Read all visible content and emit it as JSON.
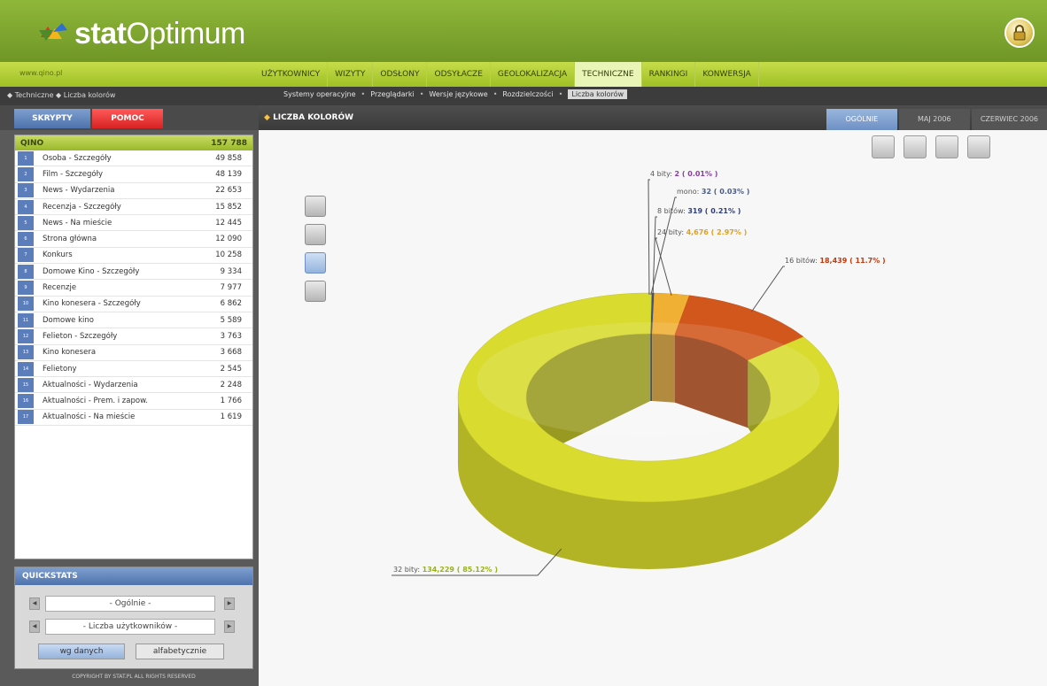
{
  "header": {
    "brand_bold": "stat",
    "brand_light": "Optimum"
  },
  "nav": {
    "site": "www.qino.pl",
    "items": [
      {
        "label": "UŻYTKOWNICY",
        "active": false
      },
      {
        "label": "WIZYTY",
        "active": false
      },
      {
        "label": "ODSŁONY",
        "active": false
      },
      {
        "label": "ODSYŁACZE",
        "active": false
      },
      {
        "label": "GEOLOKALIZACJA",
        "active": false
      },
      {
        "label": "TECHNICZNE",
        "active": true
      },
      {
        "label": "RANKINGI",
        "active": false
      },
      {
        "label": "KONWERSJA",
        "active": false
      }
    ]
  },
  "subnav": {
    "breadcrumb": "◆ Techniczne ◆ Liczba kolorów",
    "links": [
      "Systemy operacyjne",
      "Przeglądarki",
      "Wersje językowe",
      "Rozdzielczości",
      "Liczba kolorów"
    ],
    "selected": "Liczba kolorów"
  },
  "left": {
    "tab_scripts": "SKRYPTY",
    "tab_help": "POMOC",
    "site_name": "QINO",
    "site_total": "157 788",
    "rows": [
      {
        "n": "1",
        "name": "Osoba - Szczegóły",
        "value": "49 858"
      },
      {
        "n": "2",
        "name": "Film - Szczegóły",
        "value": "48 139"
      },
      {
        "n": "3",
        "name": "News - Wydarzenia",
        "value": "22 653"
      },
      {
        "n": "4",
        "name": "Recenzja - Szczegóły",
        "value": "15 852"
      },
      {
        "n": "5",
        "name": "News - Na mieście",
        "value": "12 445"
      },
      {
        "n": "6",
        "name": "Strona główna",
        "value": "12 090"
      },
      {
        "n": "7",
        "name": "Konkurs",
        "value": "10 258"
      },
      {
        "n": "8",
        "name": "Domowe Kino - Szczegóły",
        "value": "9 334"
      },
      {
        "n": "9",
        "name": "Recenzje",
        "value": "7 977"
      },
      {
        "n": "10",
        "name": "Kino konesera - Szczegóły",
        "value": "6 862"
      },
      {
        "n": "11",
        "name": "Domowe kino",
        "value": "5 589"
      },
      {
        "n": "12",
        "name": "Felieton - Szczegóły",
        "value": "3 763"
      },
      {
        "n": "13",
        "name": "Kino konesera",
        "value": "3 668"
      },
      {
        "n": "14",
        "name": "Felietony",
        "value": "2 545"
      },
      {
        "n": "15",
        "name": "Aktualności - Wydarzenia",
        "value": "2 248"
      },
      {
        "n": "16",
        "name": "Aktualności - Prem. i zapow.",
        "value": "1 766"
      },
      {
        "n": "17",
        "name": "Aktualności - Na mieście",
        "value": "1 619"
      }
    ],
    "quickstats": {
      "title": "QUICKSTATS",
      "select1": "- Ogólnie -",
      "select2": "- Liczba użytkowników -",
      "btn_data": "wg danych",
      "btn_alpha": "alfabetycznie"
    },
    "copyright": "COPYRIGHT BY STAT.PL ALL RIGHTS RESERVED"
  },
  "main": {
    "title": "LICZBA KOLORÓW",
    "periods": [
      {
        "label": "OGÓLNIE",
        "active": true
      },
      {
        "label": "MAJ 2006",
        "active": false
      },
      {
        "label": "CZERWIEC 2006",
        "active": false
      }
    ]
  },
  "chart_data": {
    "type": "pie",
    "style": "3d-donut",
    "slices": [
      {
        "label": "4 bity",
        "value": 2,
        "value_text": "2",
        "percent": 0.01,
        "percent_text": "( 0.01% )",
        "color": "#8a5a9c"
      },
      {
        "label": "mono",
        "value": 32,
        "value_text": "32",
        "percent": 0.03,
        "percent_text": "( 0.03% )",
        "color": "#5a6e9a"
      },
      {
        "label": "8 bitów",
        "value": 319,
        "value_text": "319",
        "percent": 0.21,
        "percent_text": "( 0.21% )",
        "color": "#3e4f86"
      },
      {
        "label": "24 bity",
        "value": 4676,
        "value_text": "4,676",
        "percent": 2.97,
        "percent_text": "( 2.97% )",
        "color": "#f0b033"
      },
      {
        "label": "16 bitów",
        "value": 18439,
        "value_text": "18,439",
        "percent": 11.7,
        "percent_text": "( 11.7% )",
        "color": "#d2571d"
      },
      {
        "label": "32 bity",
        "value": 134229,
        "value_text": "134,229",
        "percent": 85.12,
        "percent_text": "( 85.12% )",
        "color": "#d9db2e"
      }
    ]
  },
  "colors": {
    "brand_green": "#8fb83a",
    "nav_green": "#b8d33c",
    "blue_tab": "#5b7dba",
    "red_tab": "#e03030"
  }
}
